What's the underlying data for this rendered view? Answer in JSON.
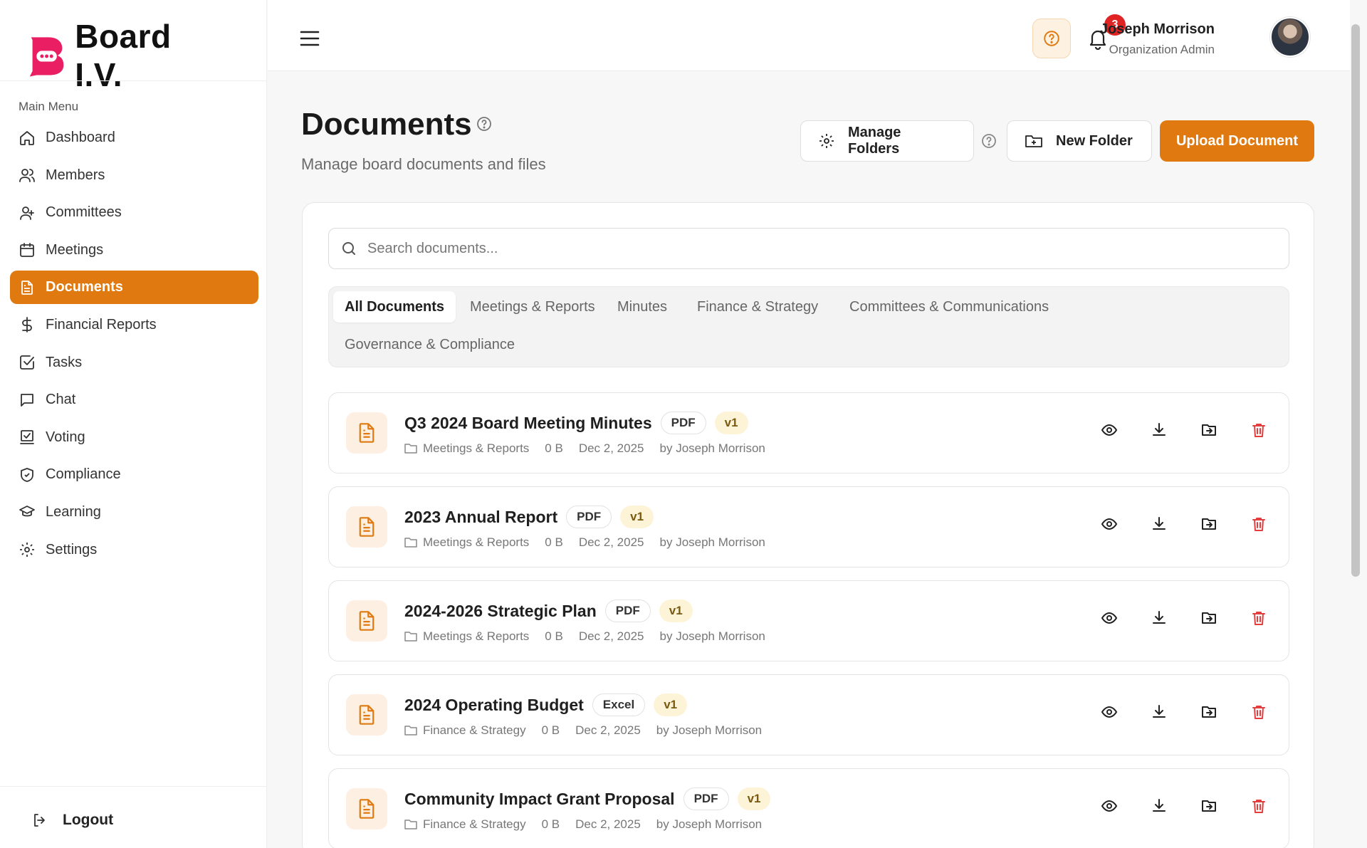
{
  "brand": {
    "name": "Board I.V.",
    "accent": "#e91e63"
  },
  "sidebar": {
    "heading": "Main Menu",
    "items": [
      {
        "label": "Dashboard",
        "icon": "home-icon"
      },
      {
        "label": "Members",
        "icon": "users-icon"
      },
      {
        "label": "Committees",
        "icon": "committee-icon"
      },
      {
        "label": "Meetings",
        "icon": "calendar-icon"
      },
      {
        "label": "Documents",
        "icon": "document-icon",
        "active": true
      },
      {
        "label": "Financial Reports",
        "icon": "dollar-icon"
      },
      {
        "label": "Tasks",
        "icon": "checkbox-icon"
      },
      {
        "label": "Chat",
        "icon": "chat-icon"
      },
      {
        "label": "Voting",
        "icon": "vote-icon"
      },
      {
        "label": "Compliance",
        "icon": "shield-icon"
      },
      {
        "label": "Learning",
        "icon": "graduation-icon"
      },
      {
        "label": "Settings",
        "icon": "gear-icon"
      }
    ],
    "logout": "Logout"
  },
  "topbar": {
    "notifications_count": "3",
    "user_name": "Joseph Morrison",
    "user_role": "Organization Admin"
  },
  "page": {
    "title": "Documents",
    "subtitle": "Manage board documents and files",
    "manage_folders": "Manage Folders",
    "new_folder": "New Folder",
    "upload": "Upload Document"
  },
  "search": {
    "placeholder": "Search documents..."
  },
  "tabs": [
    {
      "label": "All Documents",
      "active": true
    },
    {
      "label": "Meetings & Reports"
    },
    {
      "label": "Minutes"
    },
    {
      "label": "Finance & Strategy"
    },
    {
      "label": "Committees & Communications"
    },
    {
      "label": "Governance & Compliance"
    }
  ],
  "documents": [
    {
      "title": "Q3 2024 Board Meeting Minutes",
      "type": "PDF",
      "version": "v1",
      "folder": "Meetings & Reports",
      "size": "0 B",
      "date": "Dec 2, 2025",
      "author": "by Joseph Morrison"
    },
    {
      "title": "2023 Annual Report",
      "type": "PDF",
      "version": "v1",
      "folder": "Meetings & Reports",
      "size": "0 B",
      "date": "Dec 2, 2025",
      "author": "by Joseph Morrison"
    },
    {
      "title": "2024-2026 Strategic Plan",
      "type": "PDF",
      "version": "v1",
      "folder": "Meetings & Reports",
      "size": "0 B",
      "date": "Dec 2, 2025",
      "author": "by Joseph Morrison"
    },
    {
      "title": "2024 Operating Budget",
      "type": "Excel",
      "version": "v1",
      "folder": "Finance & Strategy",
      "size": "0 B",
      "date": "Dec 2, 2025",
      "author": "by Joseph Morrison"
    },
    {
      "title": "Community Impact Grant Proposal",
      "type": "PDF",
      "version": "v1",
      "folder": "Finance & Strategy",
      "size": "0 B",
      "date": "Dec 2, 2025",
      "author": "by Joseph Morrison"
    }
  ],
  "colors": {
    "primary": "#e07a10",
    "danger": "#e53e3e",
    "badge": "#e02424"
  }
}
